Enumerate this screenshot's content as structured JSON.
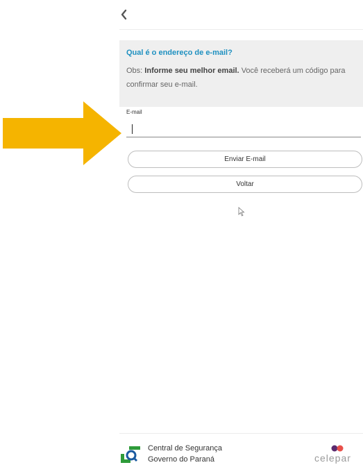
{
  "header": {
    "back_icon": "chevron-left-icon"
  },
  "info": {
    "title": "Qual é o endereço de e-mail?",
    "obs_prefix": "Obs:",
    "obs_bold": "Informe seu melhor email.",
    "obs_rest": "Você receberá um código para confirmar seu e-mail."
  },
  "form": {
    "email_label": "E-mail",
    "email_value": "",
    "send_label": "Enviar E-mail",
    "back_label": "Voltar"
  },
  "footer": {
    "gov_line1": "Central de Segurança",
    "gov_line2": "Governo do Paraná",
    "celepar": "celepar"
  },
  "colors": {
    "title_blue": "#1e90c0",
    "arrow_yellow": "#f5b400",
    "info_bg": "#efefef",
    "logo_green": "#2e9b3a",
    "logo_blue": "#1a5aa0",
    "celepar_red": "#e8504a",
    "celepar_purple": "#5b2a6e"
  }
}
